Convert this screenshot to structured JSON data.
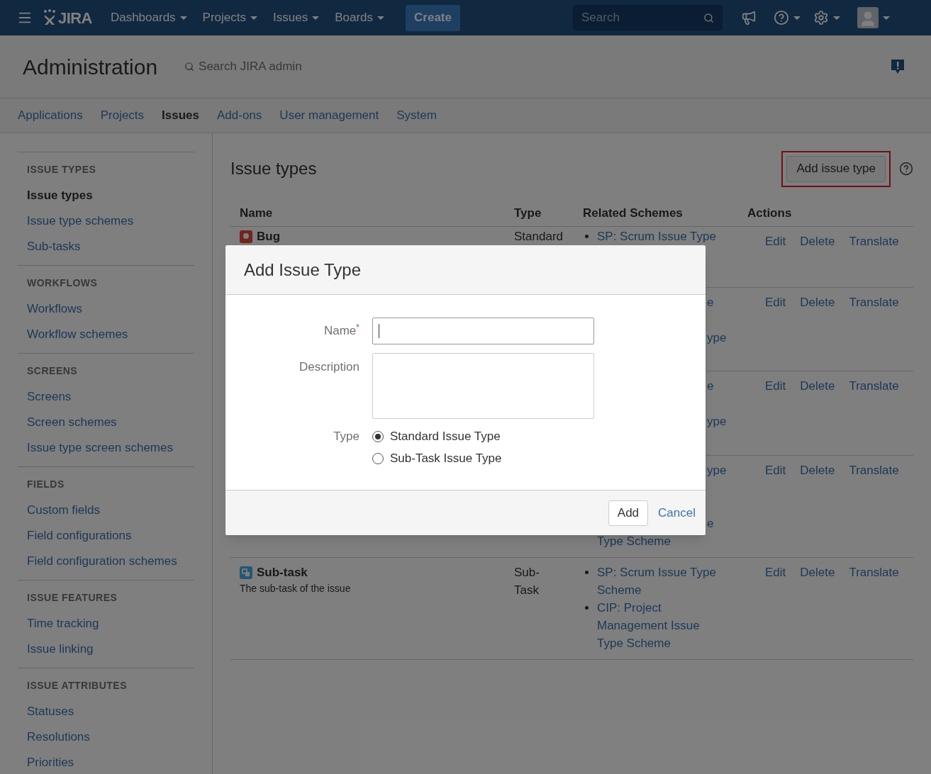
{
  "topbar": {
    "logo": "JIRA",
    "nav": [
      {
        "label": "Dashboards"
      },
      {
        "label": "Projects"
      },
      {
        "label": "Issues"
      },
      {
        "label": "Boards"
      }
    ],
    "create": "Create",
    "search": {
      "placeholder": "Search"
    }
  },
  "admin": {
    "title": "Administration",
    "search": {
      "placeholder": "Search JIRA admin"
    }
  },
  "tabs": [
    {
      "label": "Applications",
      "selected": false
    },
    {
      "label": "Projects",
      "selected": false
    },
    {
      "label": "Issues",
      "selected": true
    },
    {
      "label": "Add-ons",
      "selected": false
    },
    {
      "label": "User management",
      "selected": false
    },
    {
      "label": "System",
      "selected": false
    }
  ],
  "sidebar": {
    "sections": [
      {
        "heading": "ISSUE TYPES",
        "items": [
          {
            "label": "Issue types",
            "selected": true
          },
          {
            "label": "Issue type schemes",
            "selected": false
          },
          {
            "label": "Sub-tasks",
            "selected": false
          }
        ]
      },
      {
        "heading": "WORKFLOWS",
        "items": [
          {
            "label": "Workflows",
            "selected": false
          },
          {
            "label": "Workflow schemes",
            "selected": false
          }
        ]
      },
      {
        "heading": "SCREENS",
        "items": [
          {
            "label": "Screens",
            "selected": false
          },
          {
            "label": "Screen schemes",
            "selected": false
          },
          {
            "label": "Issue type screen schemes",
            "selected": false
          }
        ]
      },
      {
        "heading": "FIELDS",
        "items": [
          {
            "label": "Custom fields",
            "selected": false
          },
          {
            "label": "Field configurations",
            "selected": false
          },
          {
            "label": "Field configuration schemes",
            "selected": false
          }
        ]
      },
      {
        "heading": "ISSUE FEATURES",
        "items": [
          {
            "label": "Time tracking",
            "selected": false
          },
          {
            "label": "Issue linking",
            "selected": false
          }
        ]
      },
      {
        "heading": "ISSUE ATTRIBUTES",
        "items": [
          {
            "label": "Statuses",
            "selected": false
          },
          {
            "label": "Resolutions",
            "selected": false
          },
          {
            "label": "Priorities",
            "selected": false
          }
        ]
      }
    ]
  },
  "page": {
    "title": "Issue types",
    "add_button": "Add issue type",
    "highlighted": true
  },
  "table": {
    "columns": [
      "Name",
      "Type",
      "Related Schemes",
      "Actions"
    ],
    "rows": [
      {
        "name": "Bug",
        "kind": "bug",
        "type": "Standard",
        "schemes": [
          "SP: Scrum Issue Type"
        ],
        "actions": [
          "Edit",
          "Delete",
          "Translate"
        ]
      },
      {
        "scheme_fragments": [
          "e",
          "ype"
        ],
        "actions": [
          "Edit",
          "Delete",
          "Translate"
        ]
      },
      {
        "scheme_fragments": [
          "e",
          "ype"
        ],
        "actions": [
          "Edit",
          "Delete",
          "Translate"
        ]
      },
      {
        "scheme_fragments": [
          "ype",
          "e",
          "Type Scheme"
        ],
        "actions": [
          "Edit",
          "Delete",
          "Translate"
        ]
      },
      {
        "name": "Sub-task",
        "kind": "subtask",
        "description": "The sub-task of the issue",
        "type": "Sub-Task",
        "schemes": [
          "SP: Scrum Issue Type Scheme",
          "CIP: Project Management Issue Type Scheme"
        ],
        "actions": [
          "Edit",
          "Delete",
          "Translate"
        ]
      }
    ]
  },
  "dialog": {
    "title": "Add Issue Type",
    "fields": [
      {
        "kind": "text",
        "label": "Name",
        "required_mark": "*",
        "focused": true
      },
      {
        "kind": "textarea",
        "label": "Description"
      },
      {
        "kind": "radio",
        "label": "Type",
        "options": [
          {
            "label": "Standard Issue Type",
            "selected": true
          },
          {
            "label": "Sub-Task Issue Type",
            "selected": false
          }
        ]
      }
    ],
    "submit": "Add",
    "cancel": "Cancel"
  }
}
